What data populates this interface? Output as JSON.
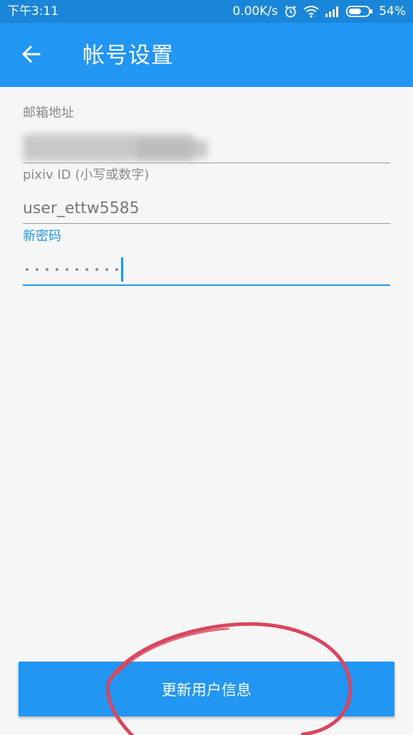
{
  "status_bar": {
    "time": "下午3:11",
    "network_speed": "0.00K/s",
    "battery": "54%",
    "icons": [
      "alarm-icon",
      "wifi-icon",
      "signal-icon",
      "battery-icon"
    ]
  },
  "app_bar": {
    "back_icon": "arrow-left-icon",
    "title": "帐号设置"
  },
  "form": {
    "email": {
      "label": "邮箱地址",
      "value": ""
    },
    "pixiv_id": {
      "label": "pixiv ID (小写或数字)",
      "value": "user_ettw5585"
    },
    "password": {
      "label": "新密码",
      "masked_length": 10
    }
  },
  "update_button": {
    "label": "更新用户信息"
  },
  "colors": {
    "status_bar": "#1a86d9",
    "primary": "#2196f3",
    "annotation_circle": "#d9465d",
    "background": "#f6f6f6"
  }
}
